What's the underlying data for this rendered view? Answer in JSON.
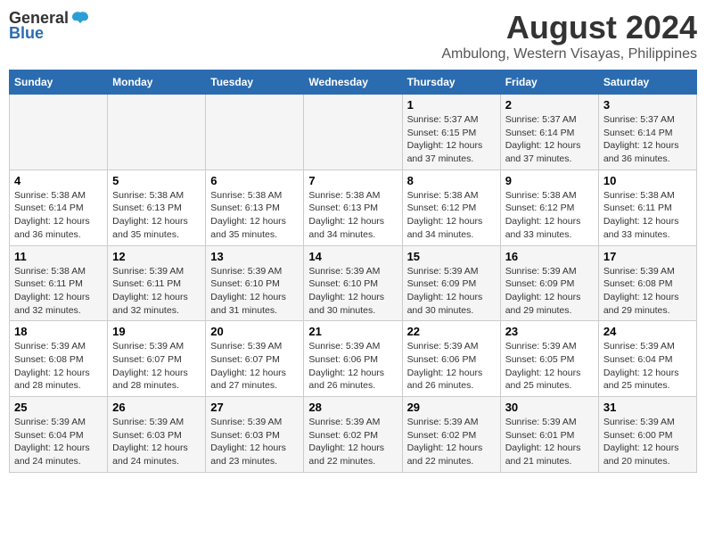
{
  "logo": {
    "general": "General",
    "blue": "Blue"
  },
  "title": "August 2024",
  "subtitle": "Ambulong, Western Visayas, Philippines",
  "days_header": [
    "Sunday",
    "Monday",
    "Tuesday",
    "Wednesday",
    "Thursday",
    "Friday",
    "Saturday"
  ],
  "weeks": [
    {
      "row": 1,
      "cells": [
        {
          "day": "",
          "info": ""
        },
        {
          "day": "",
          "info": ""
        },
        {
          "day": "",
          "info": ""
        },
        {
          "day": "",
          "info": ""
        },
        {
          "day": "1",
          "info": "Sunrise: 5:37 AM\nSunset: 6:15 PM\nDaylight: 12 hours\nand 37 minutes."
        },
        {
          "day": "2",
          "info": "Sunrise: 5:37 AM\nSunset: 6:14 PM\nDaylight: 12 hours\nand 37 minutes."
        },
        {
          "day": "3",
          "info": "Sunrise: 5:37 AM\nSunset: 6:14 PM\nDaylight: 12 hours\nand 36 minutes."
        }
      ]
    },
    {
      "row": 2,
      "cells": [
        {
          "day": "4",
          "info": "Sunrise: 5:38 AM\nSunset: 6:14 PM\nDaylight: 12 hours\nand 36 minutes."
        },
        {
          "day": "5",
          "info": "Sunrise: 5:38 AM\nSunset: 6:13 PM\nDaylight: 12 hours\nand 35 minutes."
        },
        {
          "day": "6",
          "info": "Sunrise: 5:38 AM\nSunset: 6:13 PM\nDaylight: 12 hours\nand 35 minutes."
        },
        {
          "day": "7",
          "info": "Sunrise: 5:38 AM\nSunset: 6:13 PM\nDaylight: 12 hours\nand 34 minutes."
        },
        {
          "day": "8",
          "info": "Sunrise: 5:38 AM\nSunset: 6:12 PM\nDaylight: 12 hours\nand 34 minutes."
        },
        {
          "day": "9",
          "info": "Sunrise: 5:38 AM\nSunset: 6:12 PM\nDaylight: 12 hours\nand 33 minutes."
        },
        {
          "day": "10",
          "info": "Sunrise: 5:38 AM\nSunset: 6:11 PM\nDaylight: 12 hours\nand 33 minutes."
        }
      ]
    },
    {
      "row": 3,
      "cells": [
        {
          "day": "11",
          "info": "Sunrise: 5:38 AM\nSunset: 6:11 PM\nDaylight: 12 hours\nand 32 minutes."
        },
        {
          "day": "12",
          "info": "Sunrise: 5:39 AM\nSunset: 6:11 PM\nDaylight: 12 hours\nand 32 minutes."
        },
        {
          "day": "13",
          "info": "Sunrise: 5:39 AM\nSunset: 6:10 PM\nDaylight: 12 hours\nand 31 minutes."
        },
        {
          "day": "14",
          "info": "Sunrise: 5:39 AM\nSunset: 6:10 PM\nDaylight: 12 hours\nand 30 minutes."
        },
        {
          "day": "15",
          "info": "Sunrise: 5:39 AM\nSunset: 6:09 PM\nDaylight: 12 hours\nand 30 minutes."
        },
        {
          "day": "16",
          "info": "Sunrise: 5:39 AM\nSunset: 6:09 PM\nDaylight: 12 hours\nand 29 minutes."
        },
        {
          "day": "17",
          "info": "Sunrise: 5:39 AM\nSunset: 6:08 PM\nDaylight: 12 hours\nand 29 minutes."
        }
      ]
    },
    {
      "row": 4,
      "cells": [
        {
          "day": "18",
          "info": "Sunrise: 5:39 AM\nSunset: 6:08 PM\nDaylight: 12 hours\nand 28 minutes."
        },
        {
          "day": "19",
          "info": "Sunrise: 5:39 AM\nSunset: 6:07 PM\nDaylight: 12 hours\nand 28 minutes."
        },
        {
          "day": "20",
          "info": "Sunrise: 5:39 AM\nSunset: 6:07 PM\nDaylight: 12 hours\nand 27 minutes."
        },
        {
          "day": "21",
          "info": "Sunrise: 5:39 AM\nSunset: 6:06 PM\nDaylight: 12 hours\nand 26 minutes."
        },
        {
          "day": "22",
          "info": "Sunrise: 5:39 AM\nSunset: 6:06 PM\nDaylight: 12 hours\nand 26 minutes."
        },
        {
          "day": "23",
          "info": "Sunrise: 5:39 AM\nSunset: 6:05 PM\nDaylight: 12 hours\nand 25 minutes."
        },
        {
          "day": "24",
          "info": "Sunrise: 5:39 AM\nSunset: 6:04 PM\nDaylight: 12 hours\nand 25 minutes."
        }
      ]
    },
    {
      "row": 5,
      "cells": [
        {
          "day": "25",
          "info": "Sunrise: 5:39 AM\nSunset: 6:04 PM\nDaylight: 12 hours\nand 24 minutes."
        },
        {
          "day": "26",
          "info": "Sunrise: 5:39 AM\nSunset: 6:03 PM\nDaylight: 12 hours\nand 24 minutes."
        },
        {
          "day": "27",
          "info": "Sunrise: 5:39 AM\nSunset: 6:03 PM\nDaylight: 12 hours\nand 23 minutes."
        },
        {
          "day": "28",
          "info": "Sunrise: 5:39 AM\nSunset: 6:02 PM\nDaylight: 12 hours\nand 22 minutes."
        },
        {
          "day": "29",
          "info": "Sunrise: 5:39 AM\nSunset: 6:02 PM\nDaylight: 12 hours\nand 22 minutes."
        },
        {
          "day": "30",
          "info": "Sunrise: 5:39 AM\nSunset: 6:01 PM\nDaylight: 12 hours\nand 21 minutes."
        },
        {
          "day": "31",
          "info": "Sunrise: 5:39 AM\nSunset: 6:00 PM\nDaylight: 12 hours\nand 20 minutes."
        }
      ]
    }
  ]
}
